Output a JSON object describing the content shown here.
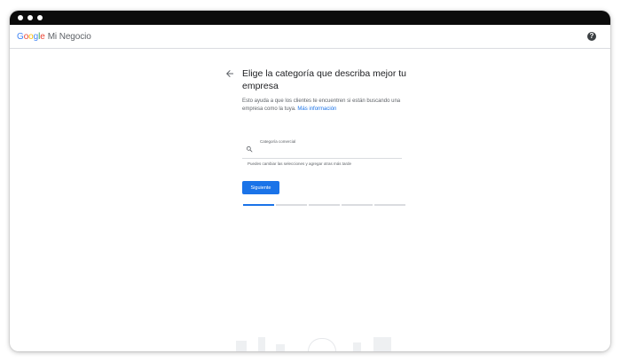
{
  "window": {
    "controls": [
      "close",
      "minimize",
      "maximize"
    ]
  },
  "header": {
    "logo_letters": [
      {
        "char": "G",
        "color": "#4285F4"
      },
      {
        "char": "o",
        "color": "#EA4335"
      },
      {
        "char": "o",
        "color": "#FBBC05"
      },
      {
        "char": "g",
        "color": "#4285F4"
      },
      {
        "char": "l",
        "color": "#34A853"
      },
      {
        "char": "e",
        "color": "#EA4335"
      }
    ],
    "product_name": "Mi Negocio",
    "help_icon": "help-circle-icon",
    "help_glyph": "?"
  },
  "main": {
    "back_icon": "arrow-left-icon",
    "heading": "Elige la categoría que describa mejor tu empresa",
    "description": "Esto ayuda a que los clientes te encuentren si están buscando una empresa como la tuya.",
    "link_text": "Más información",
    "field": {
      "icon": "search-icon",
      "label": "Categoría comercial",
      "value": "",
      "helper_text": "Puedes cambiar las selecciones y agregar otras más tarde"
    },
    "next_button_label": "Siguiente",
    "progress": {
      "steps_total": 5,
      "current_step": 1
    }
  },
  "colors": {
    "accent": "#1a73e8",
    "titlebar": "#0b0b0b",
    "divider": "#dadce0"
  }
}
